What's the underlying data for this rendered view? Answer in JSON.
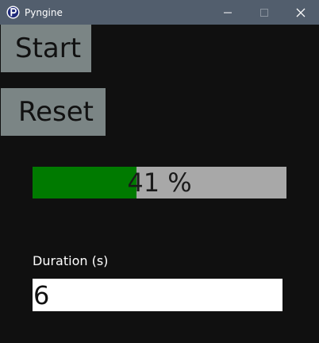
{
  "window": {
    "title": "Pyngine",
    "app_icon": "pyngine-p-logo-icon",
    "controls": [
      "minimize-icon",
      "maximize-icon",
      "close-icon"
    ]
  },
  "buttons": {
    "start_label": "Start",
    "reset_label": "Reset"
  },
  "progress": {
    "percent": 41,
    "label": "41 %",
    "fill_color": "#007a00",
    "track_color": "#a8a8a8"
  },
  "duration": {
    "label": "Duration (s)",
    "value": "6"
  },
  "colors": {
    "titlebar": "#525e6d",
    "background": "#101010",
    "button": "#7b8585"
  }
}
